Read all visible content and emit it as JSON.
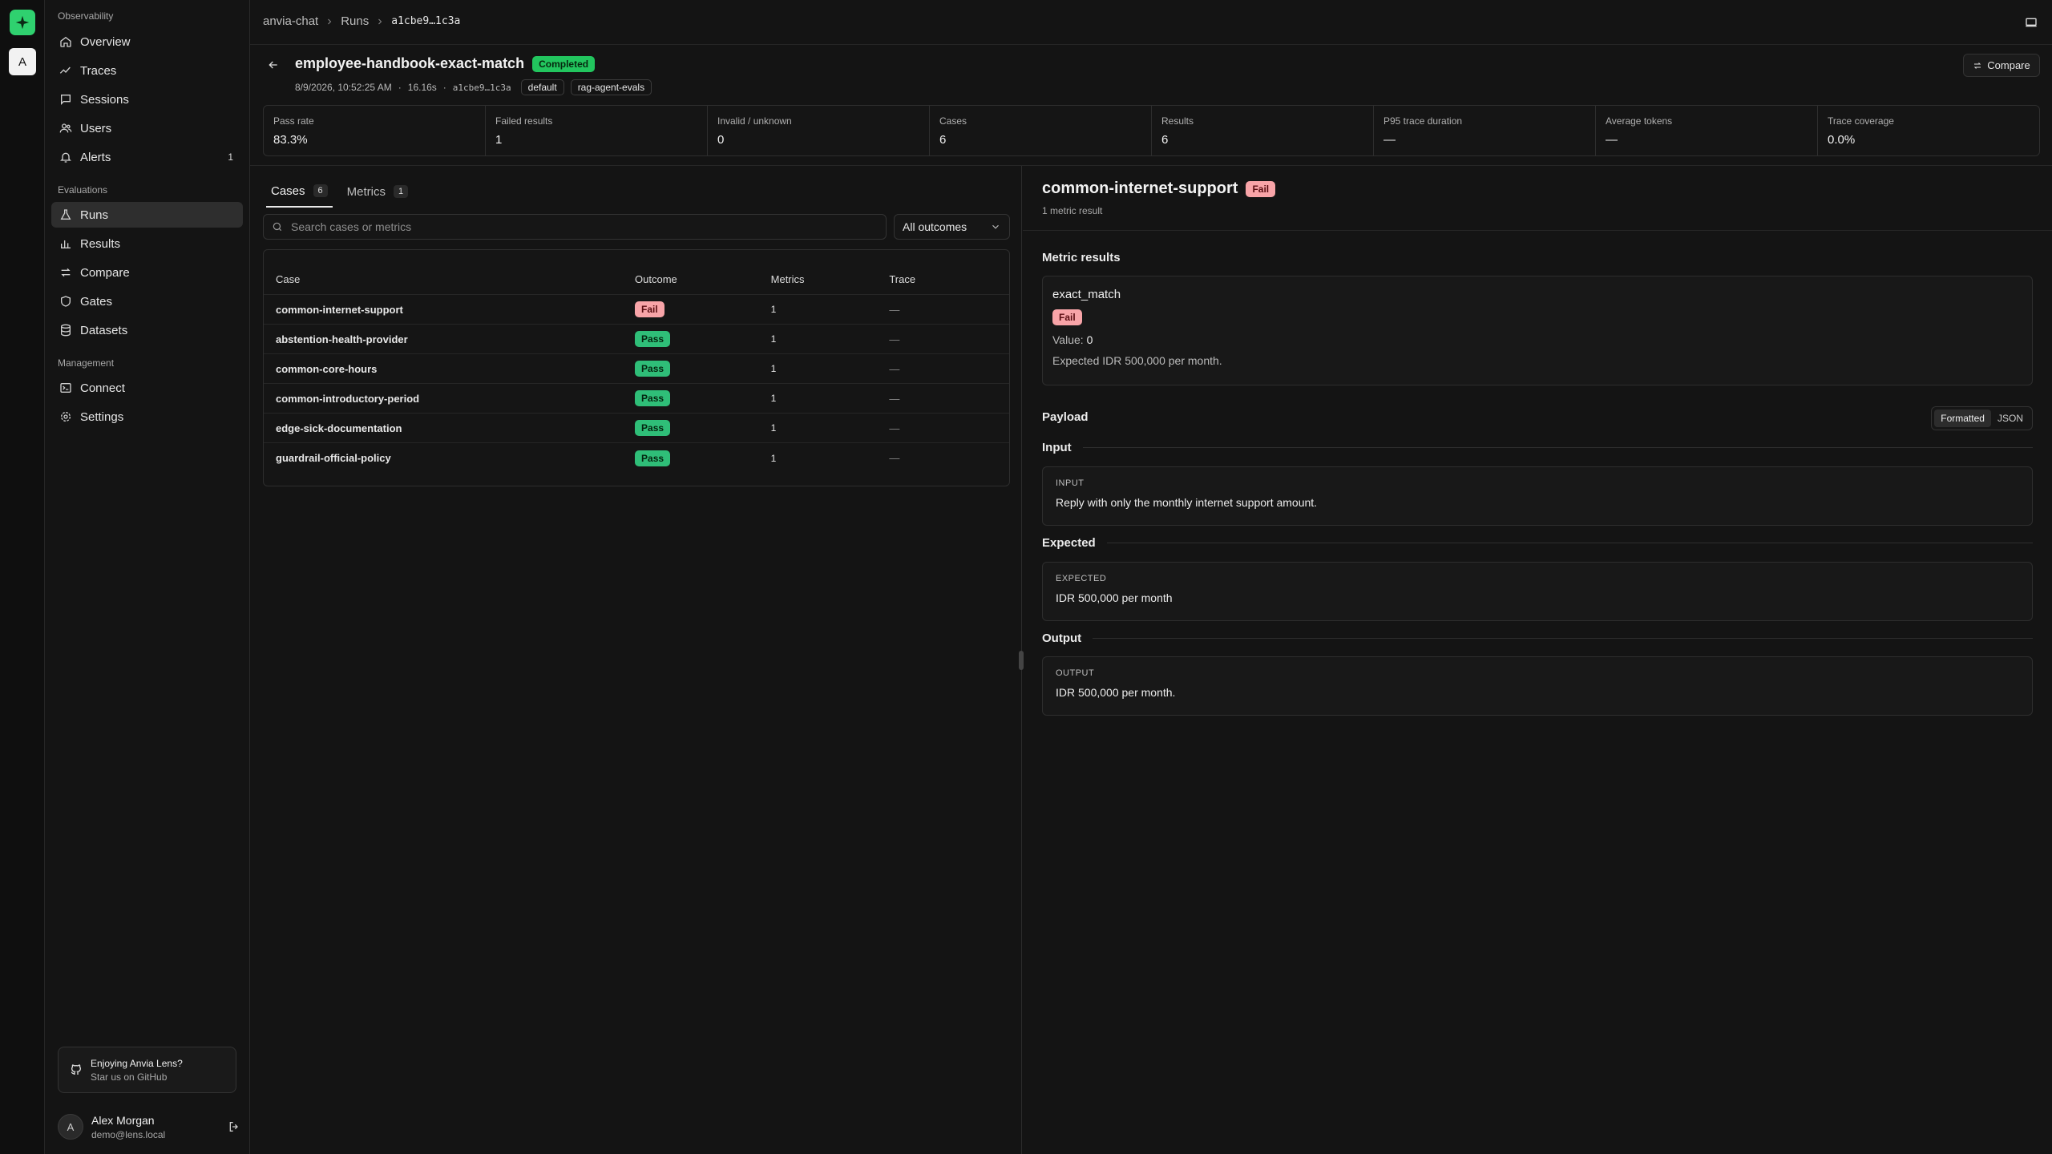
{
  "rail": {
    "workspace_initial": "A"
  },
  "sidebar": {
    "section_observability": "Observability",
    "overview": "Overview",
    "traces": "Traces",
    "sessions": "Sessions",
    "users": "Users",
    "alerts": "Alerts",
    "alerts_count": "1",
    "section_evaluations": "Evaluations",
    "runs": "Runs",
    "results": "Results",
    "compare": "Compare",
    "gates": "Gates",
    "datasets": "Datasets",
    "section_management": "Management",
    "connect": "Connect",
    "settings": "Settings",
    "promo_title": "Enjoying Anvia Lens?",
    "promo_sub": "Star us on GitHub",
    "user_initial": "A",
    "user_name": "Alex Morgan",
    "user_email": "demo@lens.local"
  },
  "breadcrumb": {
    "project": "anvia-chat",
    "section": "Runs",
    "run_id": "a1cbe9…1c3a"
  },
  "run": {
    "title": "employee-handbook-exact-match",
    "status": "Completed",
    "timestamp": "8/9/2026, 10:52:25 AM",
    "duration": "16.16s",
    "run_id": "a1cbe9…1c3a",
    "tags": [
      "default",
      "rag-agent-evals"
    ],
    "compare_label": "Compare"
  },
  "stats": [
    {
      "label": "Pass rate",
      "value": "83.3%"
    },
    {
      "label": "Failed results",
      "value": "1"
    },
    {
      "label": "Invalid / unknown",
      "value": "0"
    },
    {
      "label": "Cases",
      "value": "6"
    },
    {
      "label": "Results",
      "value": "6"
    },
    {
      "label": "P95 trace duration",
      "value": "—"
    },
    {
      "label": "Average tokens",
      "value": "—"
    },
    {
      "label": "Trace coverage",
      "value": "0.0%"
    }
  ],
  "tabs": [
    {
      "label": "Cases",
      "count": "6"
    },
    {
      "label": "Metrics",
      "count": "1"
    }
  ],
  "search": {
    "placeholder": "Search cases or metrics"
  },
  "filter": {
    "value": "All outcomes"
  },
  "table": {
    "headers": [
      "Case",
      "Outcome",
      "Metrics",
      "Trace"
    ],
    "rows": [
      {
        "case": "common-internet-support",
        "outcome": "Fail",
        "metrics": "1",
        "trace": "—"
      },
      {
        "case": "abstention-health-provider",
        "outcome": "Pass",
        "metrics": "1",
        "trace": "—"
      },
      {
        "case": "common-core-hours",
        "outcome": "Pass",
        "metrics": "1",
        "trace": "—"
      },
      {
        "case": "common-introductory-period",
        "outcome": "Pass",
        "metrics": "1",
        "trace": "—"
      },
      {
        "case": "edge-sick-documentation",
        "outcome": "Pass",
        "metrics": "1",
        "trace": "—"
      },
      {
        "case": "guardrail-official-policy",
        "outcome": "Pass",
        "metrics": "1",
        "trace": "—"
      }
    ]
  },
  "detail": {
    "title": "common-internet-support",
    "badge": "Fail",
    "subtitle": "1 metric result",
    "metric_results_heading": "Metric results",
    "metric": {
      "name": "exact_match",
      "badge": "Fail",
      "value_label": "Value:",
      "value": "0",
      "expected": "Expected IDR 500,000 per month."
    },
    "payload_heading": "Payload",
    "view_formatted": "Formatted",
    "view_json": "JSON",
    "input_heading": "Input",
    "input_label": "INPUT",
    "input_text": "Reply with only the monthly internet support amount.",
    "expected_heading": "Expected",
    "expected_label": "EXPECTED",
    "expected_text": "IDR 500,000 per month",
    "output_heading": "Output",
    "output_label": "OUTPUT",
    "output_text": "IDR 500,000 per month."
  },
  "colors": {
    "accent": "#2fd16f",
    "pass": "#2fbe78",
    "fail": "#f8a4a8",
    "background": "#141414"
  }
}
